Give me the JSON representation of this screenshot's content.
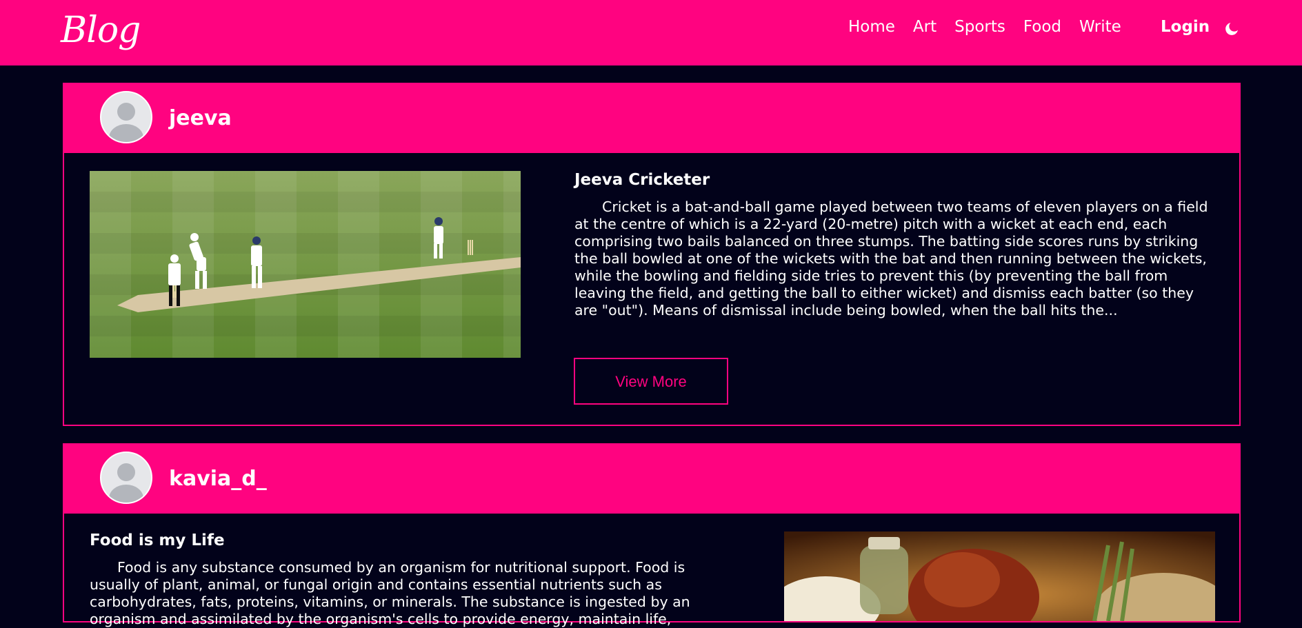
{
  "nav": {
    "brand": "Blog",
    "links": [
      "Home",
      "Art",
      "Sports",
      "Food",
      "Write"
    ],
    "login": "Login"
  },
  "posts": [
    {
      "username": "jeeva",
      "title": "Jeeva Cricketer",
      "description": "Cricket is a bat-and-ball game played between two teams of eleven players on a field at the centre of which is a 22-yard (20-metre) pitch with a wicket at each end, each comprising two bails balanced on three stumps. The batting side scores runs by striking the ball bowled at one of the wickets with the bat and then running between the wickets, while the bowling and fielding side tries to prevent this (by preventing the ball from leaving the field, and getting the ball to either wicket) and dismiss each batter (so they are \"out\"). Means of dismissal include being bowled, when the ball hits the...",
      "button": "View More"
    },
    {
      "username": "kavia_d_",
      "title": "Food is my Life",
      "description": "Food is any substance consumed by an organism for nutritional support. Food is usually of plant, animal, or fungal origin and contains essential nutrients such as carbohydrates, fats, proteins, vitamins, or minerals. The substance is ingested by an organism and assimilated by the organism's cells to provide energy, maintain life,"
    }
  ],
  "colors": {
    "accent": "#ff0380",
    "background": "#02021a"
  },
  "icons": {
    "theme_toggle": "moon-icon",
    "avatar": "user-avatar-icon"
  }
}
